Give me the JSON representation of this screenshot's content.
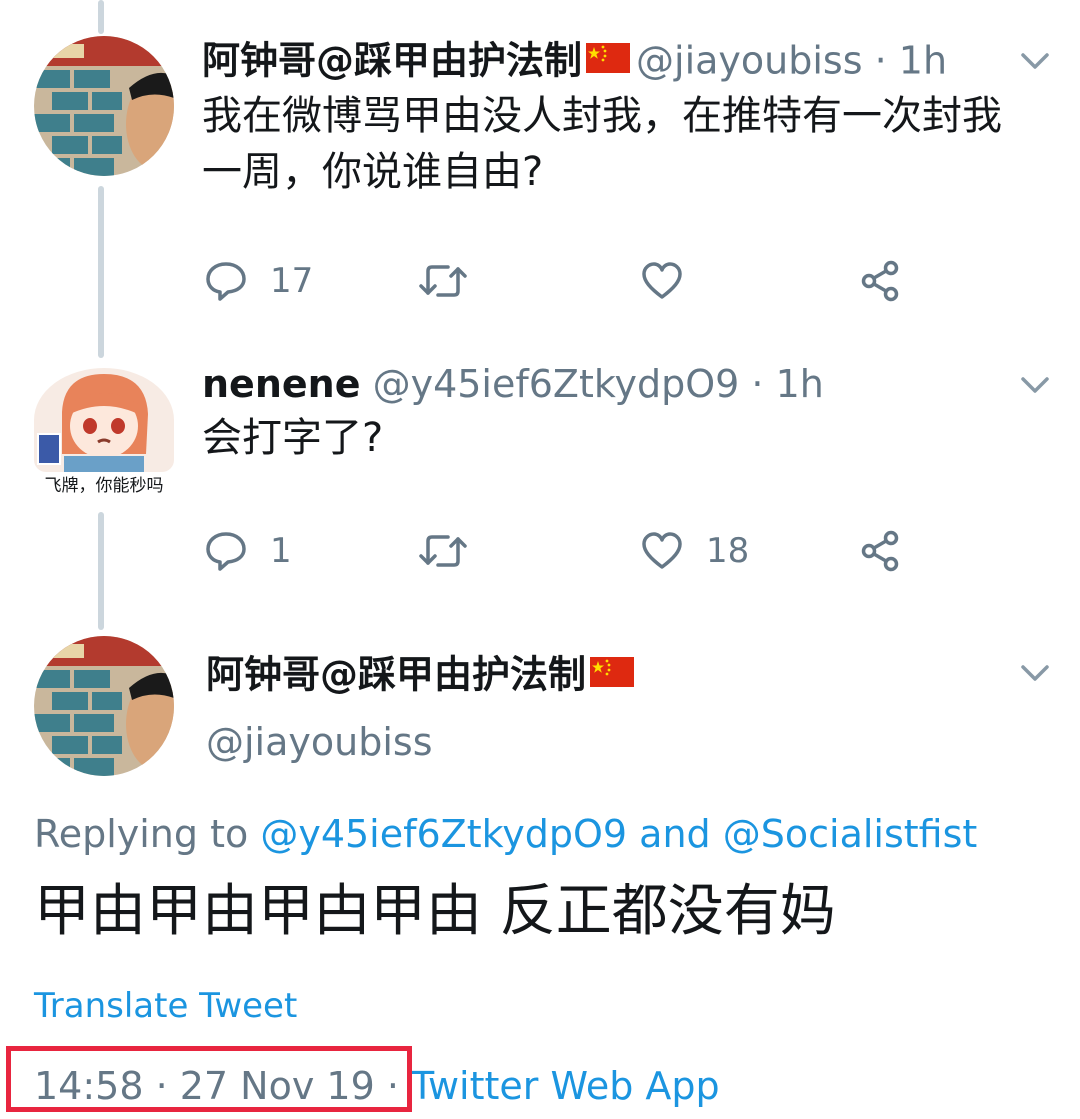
{
  "tweets": [
    {
      "name": "阿钟哥@踩甲由护法制",
      "handle": "@jiayoubiss",
      "separator": "·",
      "time": "1h",
      "text_line1": "我在微博骂甲由没人封我，在推特有一次封我",
      "text_line2": "一周，你说谁自由?",
      "reply_count": "17",
      "retweet_count": "",
      "like_count": "",
      "avatar_icon": "bricks-wall-avatar"
    },
    {
      "name": "nenene",
      "handle": "@y45ief6ZtkydpO9",
      "separator": "·",
      "time": "1h",
      "text": "会打字了?",
      "reply_count": "1",
      "retweet_count": "",
      "like_count": "18",
      "avatar_caption": "飞牌，你能秒吗",
      "avatar_icon": "anime-girl-avatar"
    }
  ],
  "focused_tweet": {
    "name": "阿钟哥@踩甲由护法制",
    "handle": "@jiayoubiss",
    "replying_prefix": "Replying to",
    "replying_user1": "@y45ief6ZtkydpO9",
    "replying_and": "and",
    "replying_user2": "@Socialistfist",
    "text": "甲由甲由甲甴甲由 反正都没有妈",
    "translate_label": "Translate Tweet",
    "timestamp": "14:58 · 27 Nov 19 ·",
    "source_app": "Twitter Web App"
  },
  "colors": {
    "link_blue": "#1b95e0",
    "secondary_gray": "#657786",
    "thread_line": "#ccd6dd",
    "highlight_red": "#e8253f",
    "flag_red": "#de2910",
    "flag_yellow": "#ffde00"
  },
  "icons": {
    "reply": "reply-icon",
    "retweet": "retweet-icon",
    "like": "heart-icon",
    "share": "share-icon",
    "more": "chevron-down-icon",
    "flag": "china-flag-icon"
  }
}
